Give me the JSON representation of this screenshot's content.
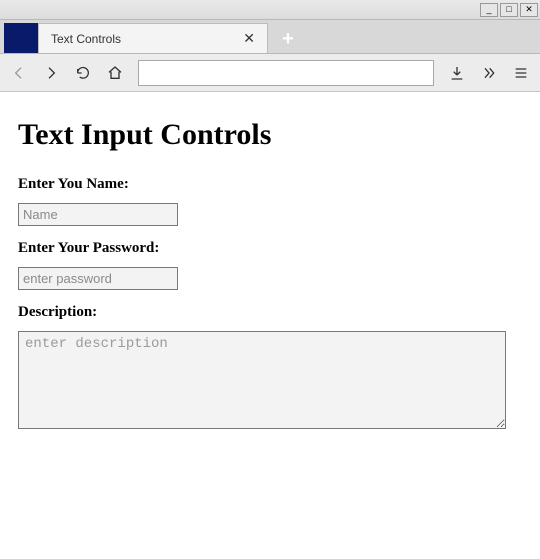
{
  "window": {
    "minimize_glyph": "_",
    "maximize_glyph": "□",
    "close_glyph": "✕"
  },
  "tab": {
    "title": "Text Controls",
    "close_glyph": "✕",
    "new_glyph": "+"
  },
  "toolbar": {
    "url_value": ""
  },
  "page": {
    "heading": "Text Input Controls",
    "name_label": "Enter You Name:",
    "name_placeholder": "Name",
    "name_value": "",
    "password_label": "Enter Your Password:",
    "password_placeholder": "enter password",
    "password_value": "",
    "description_label": "Description:",
    "description_placeholder": "enter description",
    "description_value": ""
  }
}
